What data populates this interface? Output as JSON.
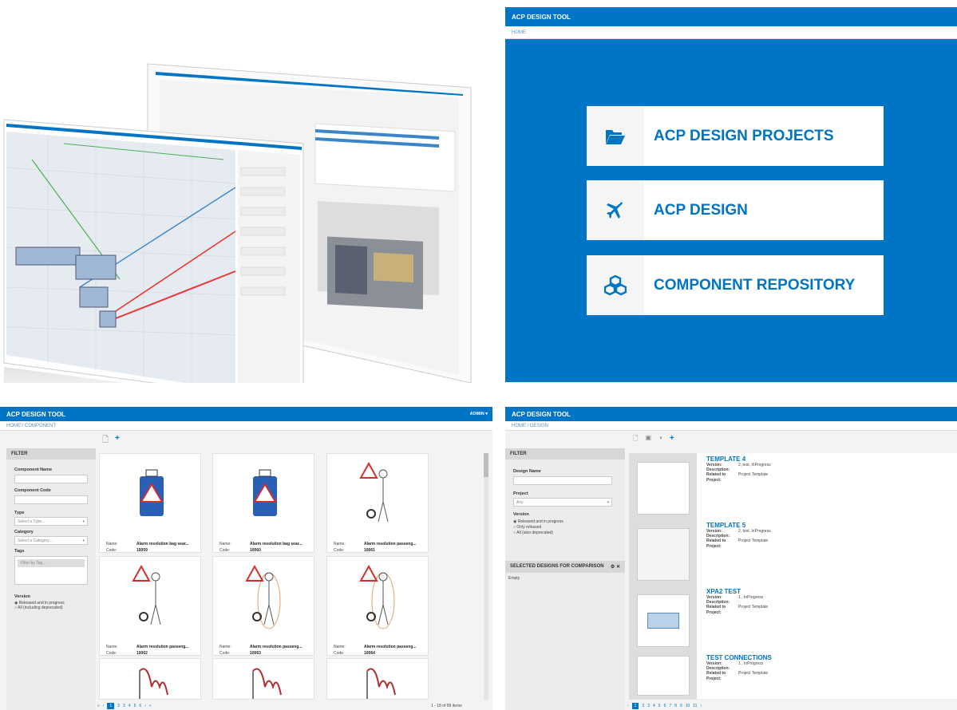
{
  "home": {
    "title": "ACP DESIGN TOOL",
    "breadcrumb": "HOME",
    "menu": [
      {
        "label": "ACP DESIGN PROJECTS",
        "icon": "folder-open-icon"
      },
      {
        "label": "ACP DESIGN",
        "icon": "plane-icon"
      },
      {
        "label": "COMPONENT REPOSITORY",
        "icon": "cubes-icon"
      }
    ]
  },
  "component": {
    "title": "ACP DESIGN TOOL",
    "admin": "ADMIN",
    "breadcrumb": [
      "HOME",
      "COMPONENT"
    ],
    "filter": {
      "heading": "FILTER",
      "name_label": "Component Name",
      "code_label": "Component Code",
      "type_label": "Type",
      "type_value": "Select a Type...",
      "category_label": "Category",
      "category_value": "Select a Category...",
      "tags_label": "Tags",
      "tags_placeholder": "Filter by Tag...",
      "version_label": "Version",
      "version_options": [
        "Released and in progress",
        "All (including deprecated)"
      ]
    },
    "name_label": "Name:",
    "code_label": "Code:",
    "cards": [
      {
        "name": "Alarm resolution bag sear...",
        "code": "10059"
      },
      {
        "name": "Alarm resolution bag sear...",
        "code": "10060"
      },
      {
        "name": "Alarm resolution passeng...",
        "code": "10061"
      },
      {
        "name": "Alarm resolution passeng...",
        "code": "10062"
      },
      {
        "name": "Alarm resolution passeng...",
        "code": "10063"
      },
      {
        "name": "Alarm resolution passeng...",
        "code": "10064"
      }
    ],
    "pagination": [
      "1",
      "2",
      "3",
      "4",
      "5",
      "6"
    ],
    "items_info": "1 - 18 of 99 items"
  },
  "design": {
    "title": "ACP DESIGN TOOL",
    "breadcrumb": [
      "HOME",
      "DESIGN"
    ],
    "filter": {
      "heading": "FILTER",
      "name_label": "Design Name",
      "project_label": "Project",
      "project_value": "Any",
      "version_label": "Version",
      "version_options": [
        "Released and in progress",
        "Only released",
        "All (also deprecated)"
      ]
    },
    "comparison": {
      "heading": "SELECTED DESIGNS FOR COMPARISON",
      "empty": "Empty"
    },
    "labels": {
      "version": "Version:",
      "description": "Description:",
      "related": "Related to",
      "project": "Project:"
    },
    "designs": [
      {
        "title": "TEMPLATE 4",
        "version": "2, test, InProgress",
        "related": "Project Template"
      },
      {
        "title": "TEMPLATE 5",
        "version": "2, test, InProgress",
        "related": "Project Template"
      },
      {
        "title": "XPA2 TEST",
        "version": "1 , InProgress",
        "related": "Project Template"
      },
      {
        "title": "TEST CONNECTIONS",
        "version": "1 , InProgress",
        "related": "Project Template"
      }
    ],
    "pagination": [
      "1",
      "2",
      "3",
      "4",
      "5",
      "6",
      "7",
      "8",
      "9",
      "10",
      "11"
    ]
  }
}
